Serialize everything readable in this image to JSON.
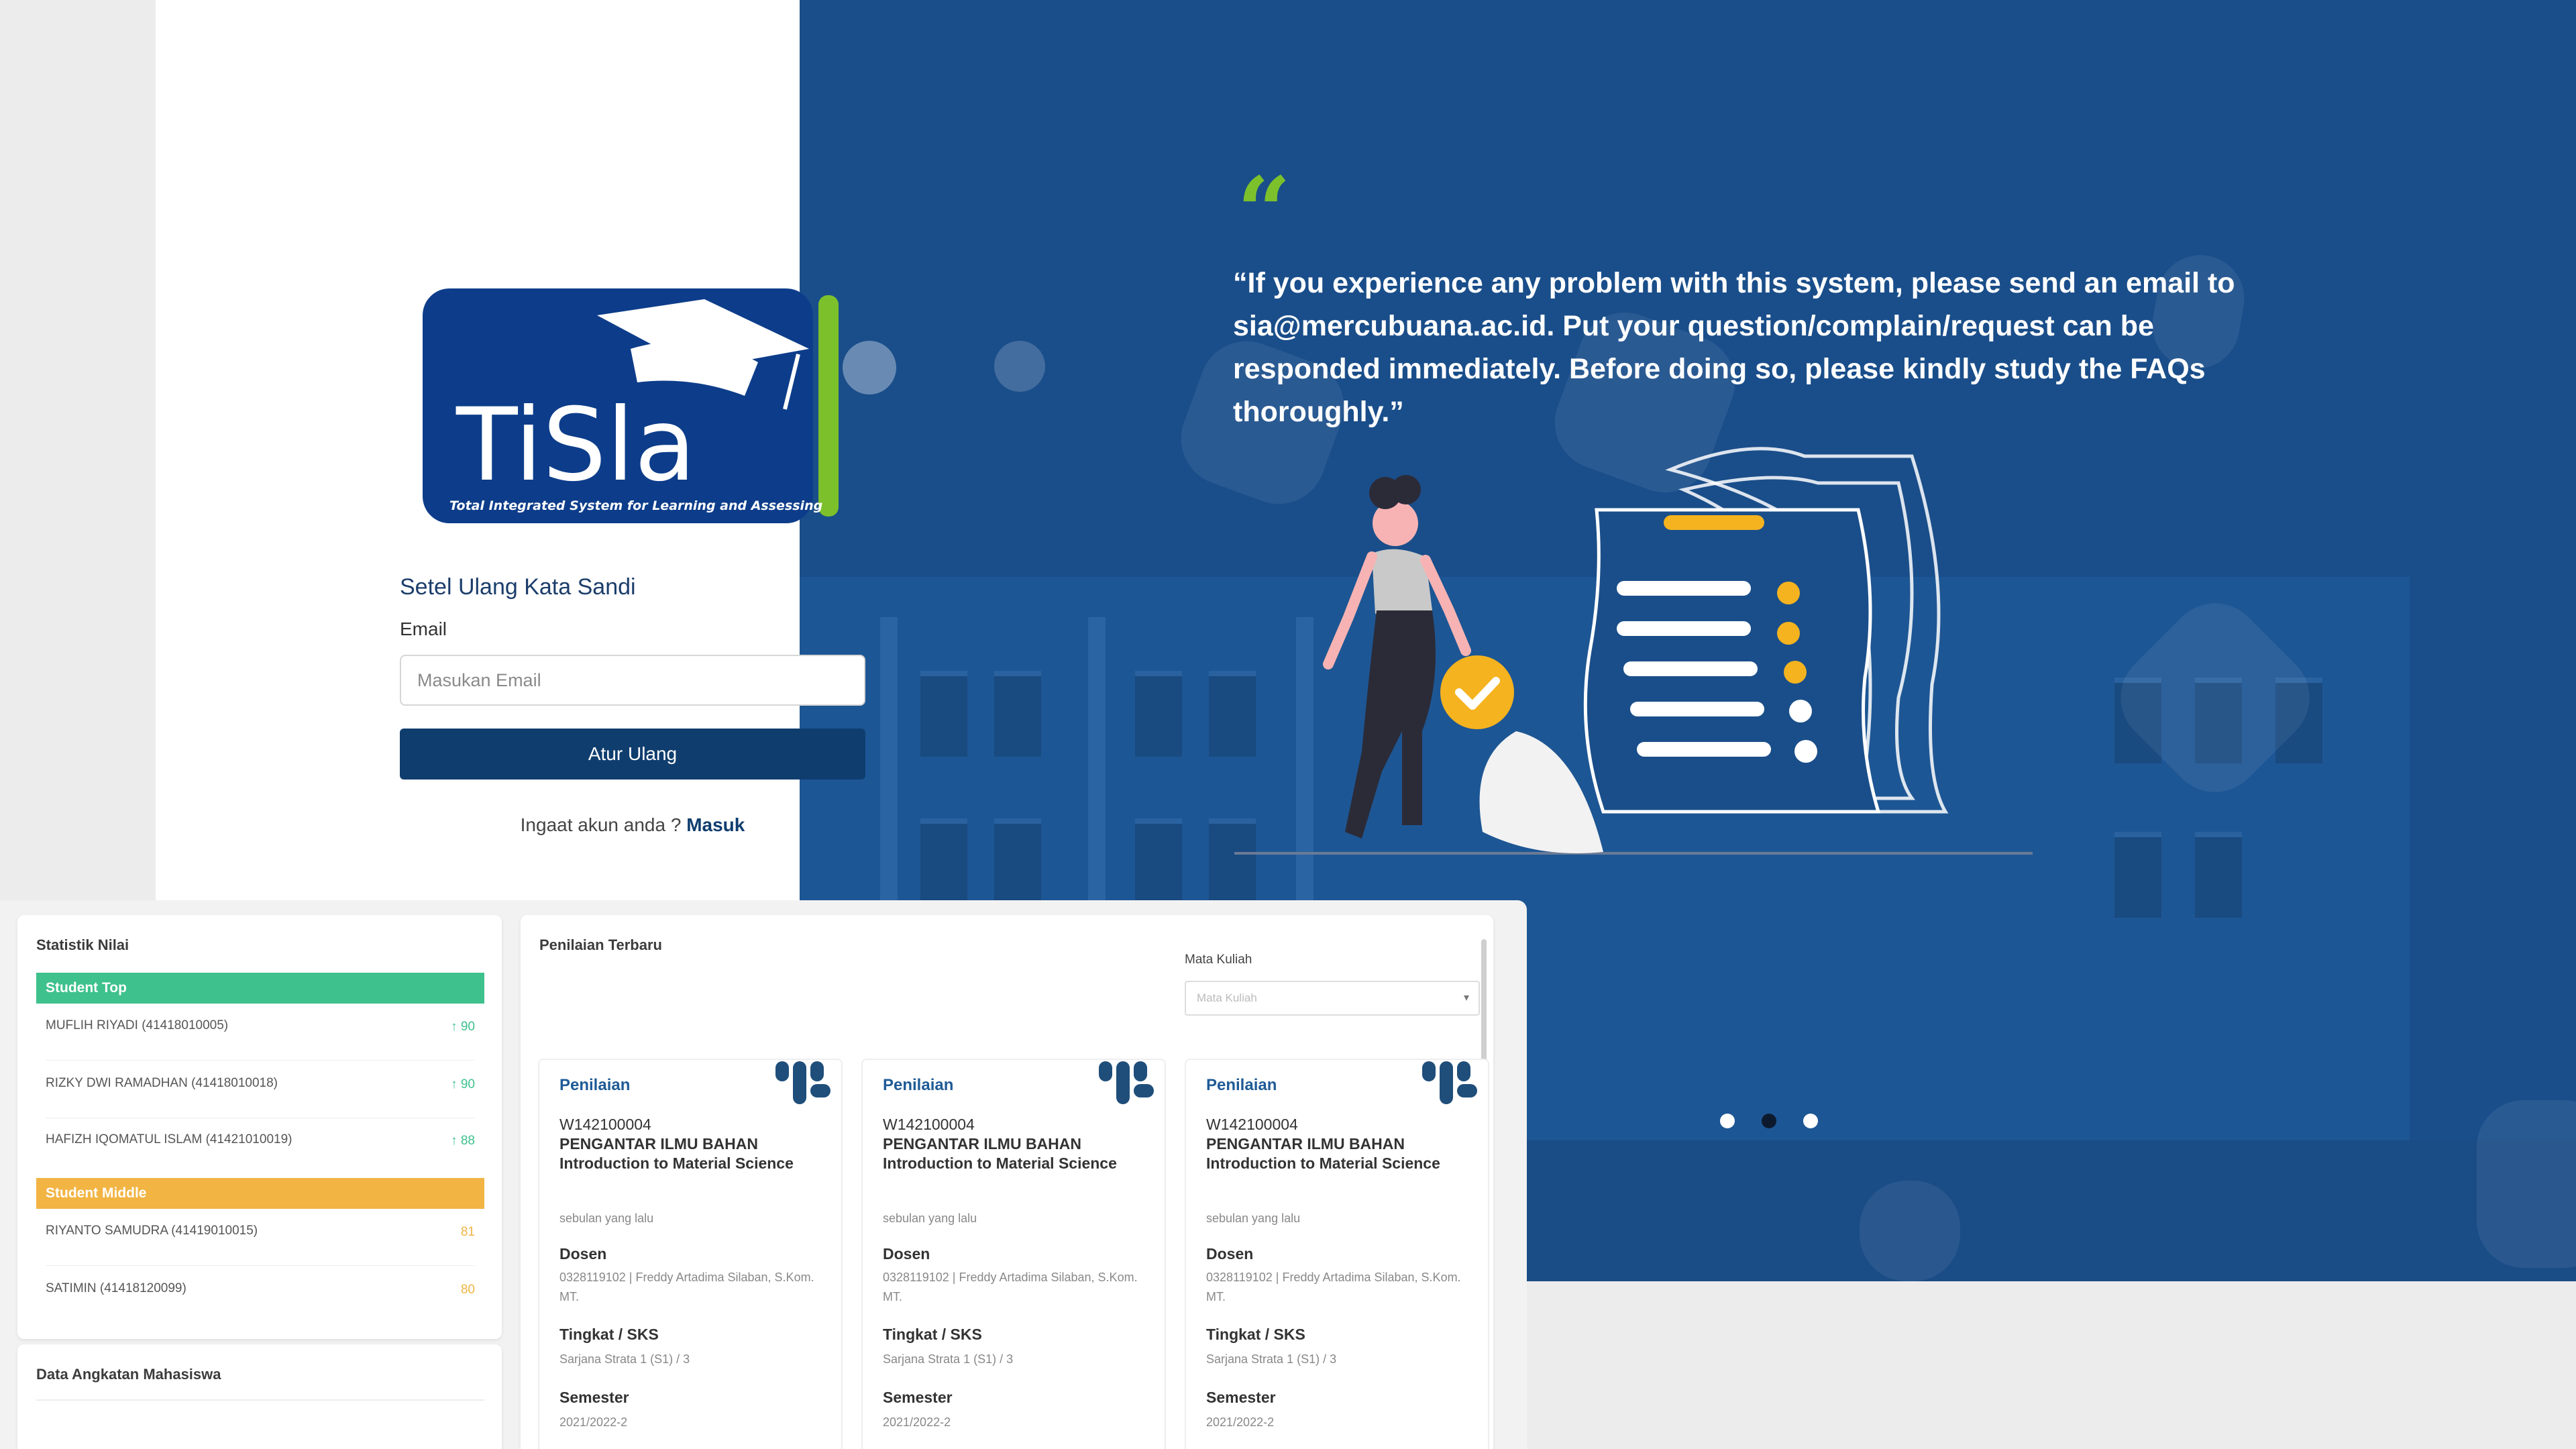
{
  "hero": {
    "quote": "“If you experience any problem with this system, please send an email to sia@mercubuana.ac.id. Put your question/complain/request can be responded immediately. Before doing so, please kindly study the FAQs thoroughly.”",
    "quote_mark": "“",
    "slides": {
      "count": 3,
      "active": 2
    },
    "colors": {
      "background": "#1a4e8a",
      "quote_mark": "#7cc12b",
      "accent": "#f5b31f"
    }
  },
  "logo": {
    "text": "TiSla",
    "tagline": "Total Integrated System for Learning and Assessing",
    "colors": {
      "primary": "#0d3d8a",
      "accent": "#7cc12b"
    }
  },
  "login": {
    "title": "Setel Ulang Kata Sandi",
    "email_label": "Email",
    "email_placeholder": "Masukan Email",
    "email_value": "",
    "submit_label": "Atur Ulang",
    "remember_text": "Ingaat akun anda ?",
    "remember_link": "Masuk"
  },
  "dashboard": {
    "stats": {
      "title": "Statistik Nilai",
      "top_label": "Student Top",
      "middle_label": "Student Middle",
      "top": [
        {
          "name": "MUFLIH RIYADI (41418010005)",
          "score": "90"
        },
        {
          "name": "RIZKY DWI RAMADHAN (41418010018)",
          "score": "90"
        },
        {
          "name": "HAFIZH IQOMATUL ISLAM (41421010019)",
          "score": "88"
        }
      ],
      "middle": [
        {
          "name": "RIYANTO SAMUDRA (41419010015)",
          "score": "81"
        },
        {
          "name": "SATIMIN (41418120099)",
          "score": "80"
        }
      ],
      "colors": {
        "top": "#3ec18c",
        "middle": "#f2b443"
      }
    },
    "angkatan": {
      "title": "Data Angkatan Mahasiswa"
    },
    "recent": {
      "title": "Penilaian Terbaru",
      "filter_label": "Mata Kuliah",
      "filter_placeholder": "Mata Kuliah",
      "cards": [
        {
          "type": "Penilaian",
          "code": "W142100004",
          "course": "PENGANTAR ILMU BAHAN Introduction to Material Science",
          "time": "sebulan yang lalu",
          "dosen_label": "Dosen",
          "dosen": "0328119102 | Freddy Artadima Silaban, S.Kom. MT.",
          "tingkat_label": "Tingkat / SKS",
          "tingkat": "Sarjana Strata 1 (S1) / 3",
          "semester_label": "Semester",
          "semester": "2021/2022-2"
        },
        {
          "type": "Penilaian",
          "code": "W142100004",
          "course": "PENGANTAR ILMU BAHAN Introduction to Material Science",
          "time": "sebulan yang lalu",
          "dosen_label": "Dosen",
          "dosen": "0328119102 | Freddy Artadima Silaban, S.Kom. MT.",
          "tingkat_label": "Tingkat / SKS",
          "tingkat": "Sarjana Strata 1 (S1) / 3",
          "semester_label": "Semester",
          "semester": "2021/2022-2"
        },
        {
          "type": "Penilaian",
          "code": "W142100004",
          "course": "PENGANTAR ILMU BAHAN Introduction to Material Science",
          "time": "sebulan yang lalu",
          "dosen_label": "Dosen",
          "dosen": "0328119102 | Freddy Artadima Silaban, S.Kom. MT.",
          "tingkat_label": "Tingkat / SKS",
          "tingkat": "Sarjana Strata 1 (S1) / 3",
          "semester_label": "Semester",
          "semester": "2021/2022-2"
        }
      ]
    }
  }
}
